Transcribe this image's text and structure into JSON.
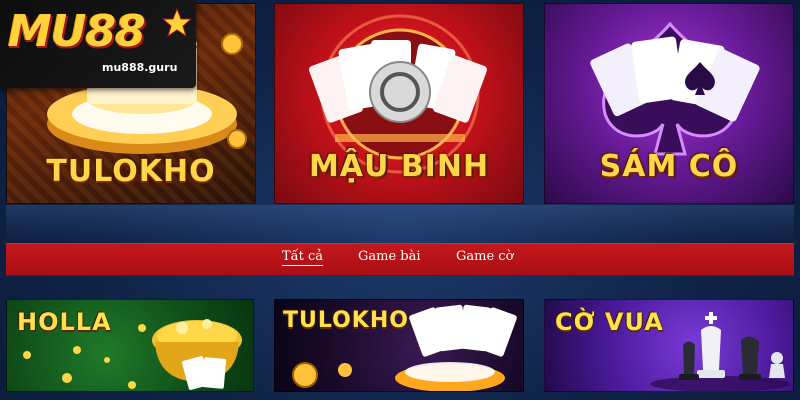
{
  "logo": {
    "text": "MU88",
    "url": "mu888.guru"
  },
  "games_top": [
    {
      "title": "TULOKHO"
    },
    {
      "title": "MẬU BINH"
    },
    {
      "title": "SÁM CÔ"
    }
  ],
  "tabs": [
    {
      "label": "Tất cả",
      "active": true
    },
    {
      "label": "Game bài",
      "active": false
    },
    {
      "label": "Game cờ",
      "active": false
    }
  ],
  "games_bottom": [
    {
      "title": "HOLLA"
    },
    {
      "title": "TULOKHO"
    },
    {
      "title": "CỜ VUA"
    }
  ],
  "colors": {
    "tab_bar": "#b5131a",
    "title_gold": "#ffd54a",
    "background": "#0f2347"
  },
  "icons": [
    "poker-chip-icon",
    "playing-cards-icon",
    "spade-icon",
    "pot-of-gold-icon",
    "chess-pieces-icon",
    "star-icon"
  ]
}
